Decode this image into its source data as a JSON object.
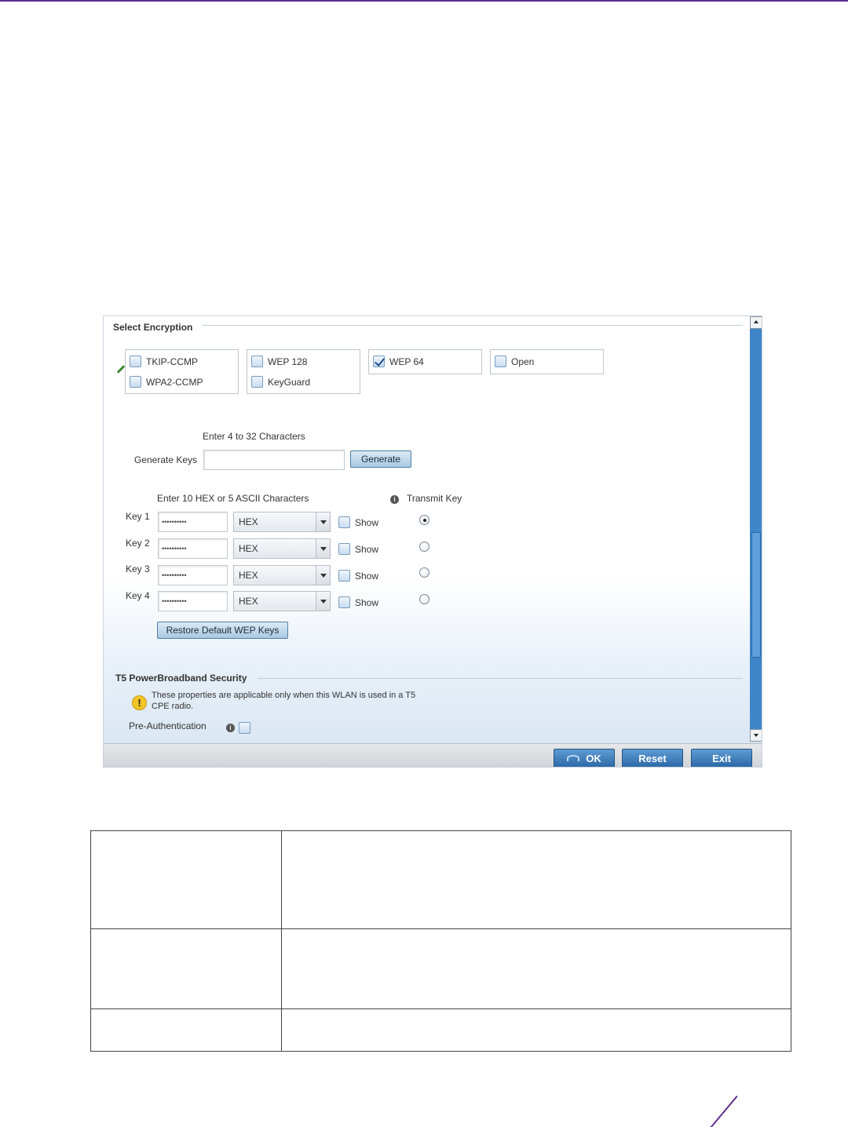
{
  "panel": {
    "encryption_group_title": "Select Encryption",
    "encryption_options": [
      {
        "label": "TKIP-CCMP",
        "checked": false
      },
      {
        "label": "WPA2-CCMP",
        "checked": false
      },
      {
        "label": "WEP 128",
        "checked": false
      },
      {
        "label": "KeyGuard",
        "checked": false
      },
      {
        "label": "WEP 64",
        "checked": true
      },
      {
        "label": "Open",
        "checked": false
      }
    ],
    "generate": {
      "hint": "Enter 4 to 32 Characters",
      "label": "Generate Keys",
      "value": "",
      "button_label": "Generate"
    },
    "keys": {
      "hint": "Enter 10 HEX or 5 ASCII Characters",
      "transmit_label": "Transmit Key",
      "show_label": "Show",
      "rows": [
        {
          "label": "Key 1",
          "value": "••••••••••",
          "format": "HEX",
          "transmit": true
        },
        {
          "label": "Key 2",
          "value": "••••••••••",
          "format": "HEX",
          "transmit": false
        },
        {
          "label": "Key 3",
          "value": "••••••••••",
          "format": "HEX",
          "transmit": false
        },
        {
          "label": "Key 4",
          "value": "••••••••••",
          "format": "HEX",
          "transmit": false
        }
      ],
      "restore_button": "Restore Default WEP Keys"
    },
    "t5": {
      "title": "T5 PowerBroadband Security",
      "warning_line1": "These properties are applicable only when this WLAN is used in a T5",
      "warning_line2": "CPE radio.",
      "pre_auth_label": "Pre-Authentication"
    },
    "footer": {
      "ok": "OK",
      "reset": "Reset",
      "exit": "Exit"
    }
  },
  "table": {
    "rows": [
      {
        "col1": "",
        "col2": ""
      },
      {
        "col1": "",
        "col2": ""
      },
      {
        "col1": "",
        "col2": ""
      }
    ]
  }
}
